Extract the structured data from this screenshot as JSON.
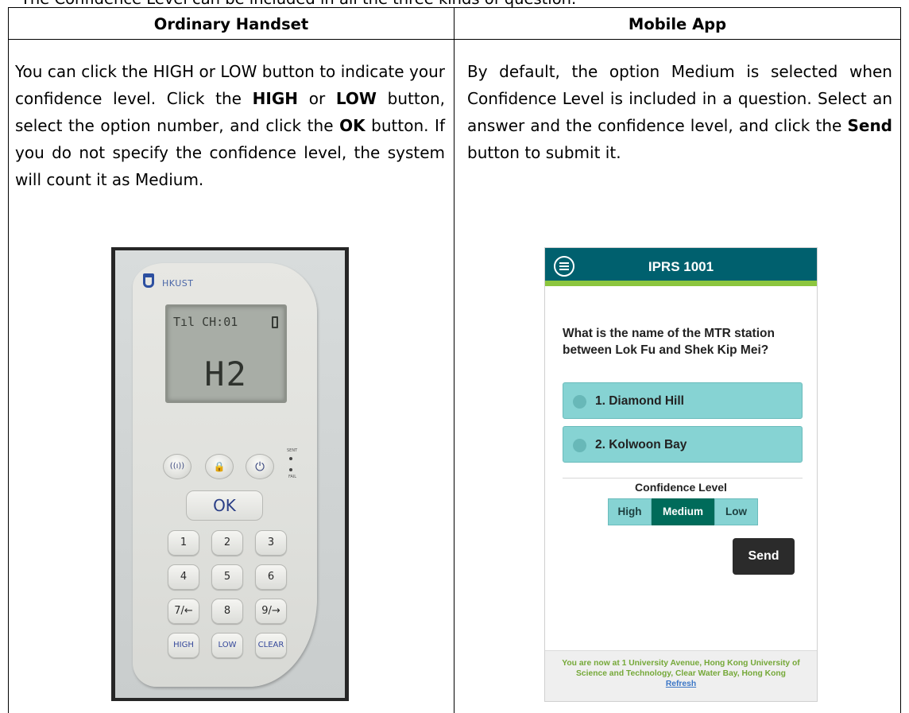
{
  "intro": "The Confidence Level can be included in all the three kinds of question.",
  "columns": {
    "left": {
      "heading": "Ordinary Handset",
      "para": {
        "p1": "You can click the HIGH or LOW button to indicate your confidence level. Click the ",
        "b1": "HIGH",
        "p2": " or ",
        "b2": "LOW",
        "p3": " button, select the option number, and click the ",
        "b3": "OK",
        "p4": " button. If you do not specify the confidence level, the system will count it as Medium."
      }
    },
    "right": {
      "heading": "Mobile App",
      "para": {
        "p1": "By default, the option Medium is selected when Confidence Level is included in a question. Select an answer and the confidence level, and click the ",
        "b1": "Send",
        "p2": " button to submit it."
      }
    }
  },
  "handset": {
    "brand": "HKUST",
    "lcd_top": "Tıl CH:01",
    "lcd_main": "H2",
    "round_buttons": [
      "((ı))",
      "🔒",
      "⏻"
    ],
    "led_labels": [
      "SENT",
      "FAIL"
    ],
    "ok": "OK",
    "keys": [
      "1",
      "2",
      "3",
      "4",
      "5",
      "6",
      "7/←",
      "8",
      "9/→",
      "HIGH",
      "LOW",
      "CLEAR"
    ]
  },
  "phone": {
    "title": "IPRS 1001",
    "question": "What is the name of the MTR station between Lok Fu and Shek Kip Mei?",
    "options": [
      "1. Diamond Hill",
      "2. Kolwoon Bay"
    ],
    "confidence_label": "Confidence Level",
    "confidence_levels": [
      "High",
      "Medium",
      "Low"
    ],
    "selected_level": "Medium",
    "send": "Send",
    "footer": "You are now at 1 University Avenue, Hong Kong University of Science and Technology, Clear Water Bay, Hong Kong",
    "refresh": "Refresh",
    "colors": {
      "header": "#00606e",
      "accent_bar": "#8cc63e",
      "option": "#86d3d3",
      "selected": "#006b5a"
    }
  }
}
